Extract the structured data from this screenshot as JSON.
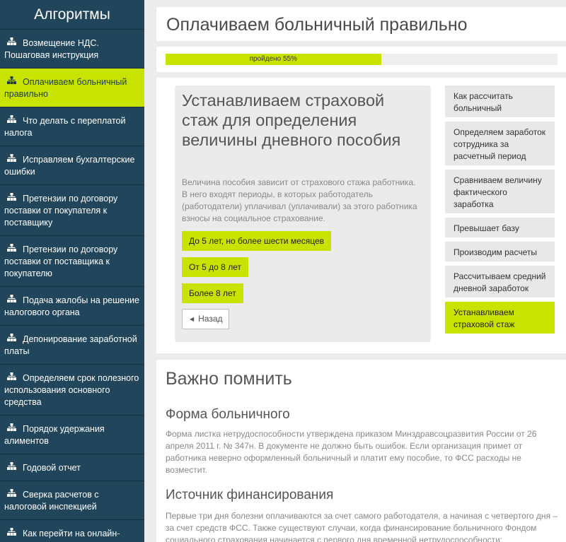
{
  "sidebar": {
    "title": "Алгоритмы",
    "items": [
      {
        "label": "Возмещение НДС. Пошаговая инструкция"
      },
      {
        "label": "Оплачиваем больничный правильно"
      },
      {
        "label": "Что делать с переплатой налога"
      },
      {
        "label": "Исправляем бухгалтерские ошибки"
      },
      {
        "label": "Претензии по договору поставки от покупателя к поставщику"
      },
      {
        "label": "Претензии по договору поставки от поставщика к покупателю"
      },
      {
        "label": "Подача жалобы на решение налогового органа"
      },
      {
        "label": "Депонирование заработной платы"
      },
      {
        "label": "Определяем срок полезного использования основного средства"
      },
      {
        "label": "Порядок удержания алиментов"
      },
      {
        "label": "Годовой отчет"
      },
      {
        "label": "Сверка расчетов с налоговой инспекцией"
      },
      {
        "label": "Как перейти на онлайн-"
      }
    ],
    "active_index": 1
  },
  "header": {
    "title": "Оплачиваем больничный правильно"
  },
  "progress": {
    "label": "пройдено 55%",
    "percent": 55
  },
  "question": {
    "title": "Устанавливаем страховой стаж для определения величины дневного пособия",
    "text": "Величина пособия зависит от страхового стажа работника. В него входят периоды, в которых работодатель (работодатели) уплачивал (уплачивали) за этого работника взносы на социальное страхование.",
    "answers": [
      {
        "label": "До 5 лет, но более шести месяцев"
      },
      {
        "label": "От 5 до 8 лет"
      },
      {
        "label": "Более 8 лет"
      }
    ],
    "back_label": "Назад"
  },
  "steps": [
    {
      "label": "Как рассчитать больничный"
    },
    {
      "label": "Определяем заработок сотрудника за расчетный период"
    },
    {
      "label": "Сравниваем величину фактического заработка"
    },
    {
      "label": "Превышает базу"
    },
    {
      "label": "Производим расчеты"
    },
    {
      "label": "Рассчитываем средний дневной заработок"
    },
    {
      "label": "Устанавливаем страховой стаж"
    }
  ],
  "memo": {
    "title": "Важно помнить",
    "sections": [
      {
        "heading": "Форма больничного",
        "text": "Форма листка нетрудоспособности утверждена приказом Минздравсоцразвития России от 26 апреля 2011 г. № 347н. В документе не должно быть ошибок. Если организация примет от работника неверно оформленный больничный и платит ему пособие, то ФСС расходы не возместит."
      },
      {
        "heading": "Источник финансирования",
        "text": "Первые три дня болезни оплачиваются за счет самого работодателя, а начиная с четвертого дня – за счет средств ФСС. Также существуют случаи, когда финансирование больничного Фондом социального страхования начинается с первого дня временной нетрудоспособности:"
      }
    ]
  },
  "colors": {
    "accent": "#c9e300",
    "sidebar_bg": "#21455a"
  },
  "icons": {
    "nav": "sitemap-icon",
    "back": "chevron-left-icon"
  }
}
